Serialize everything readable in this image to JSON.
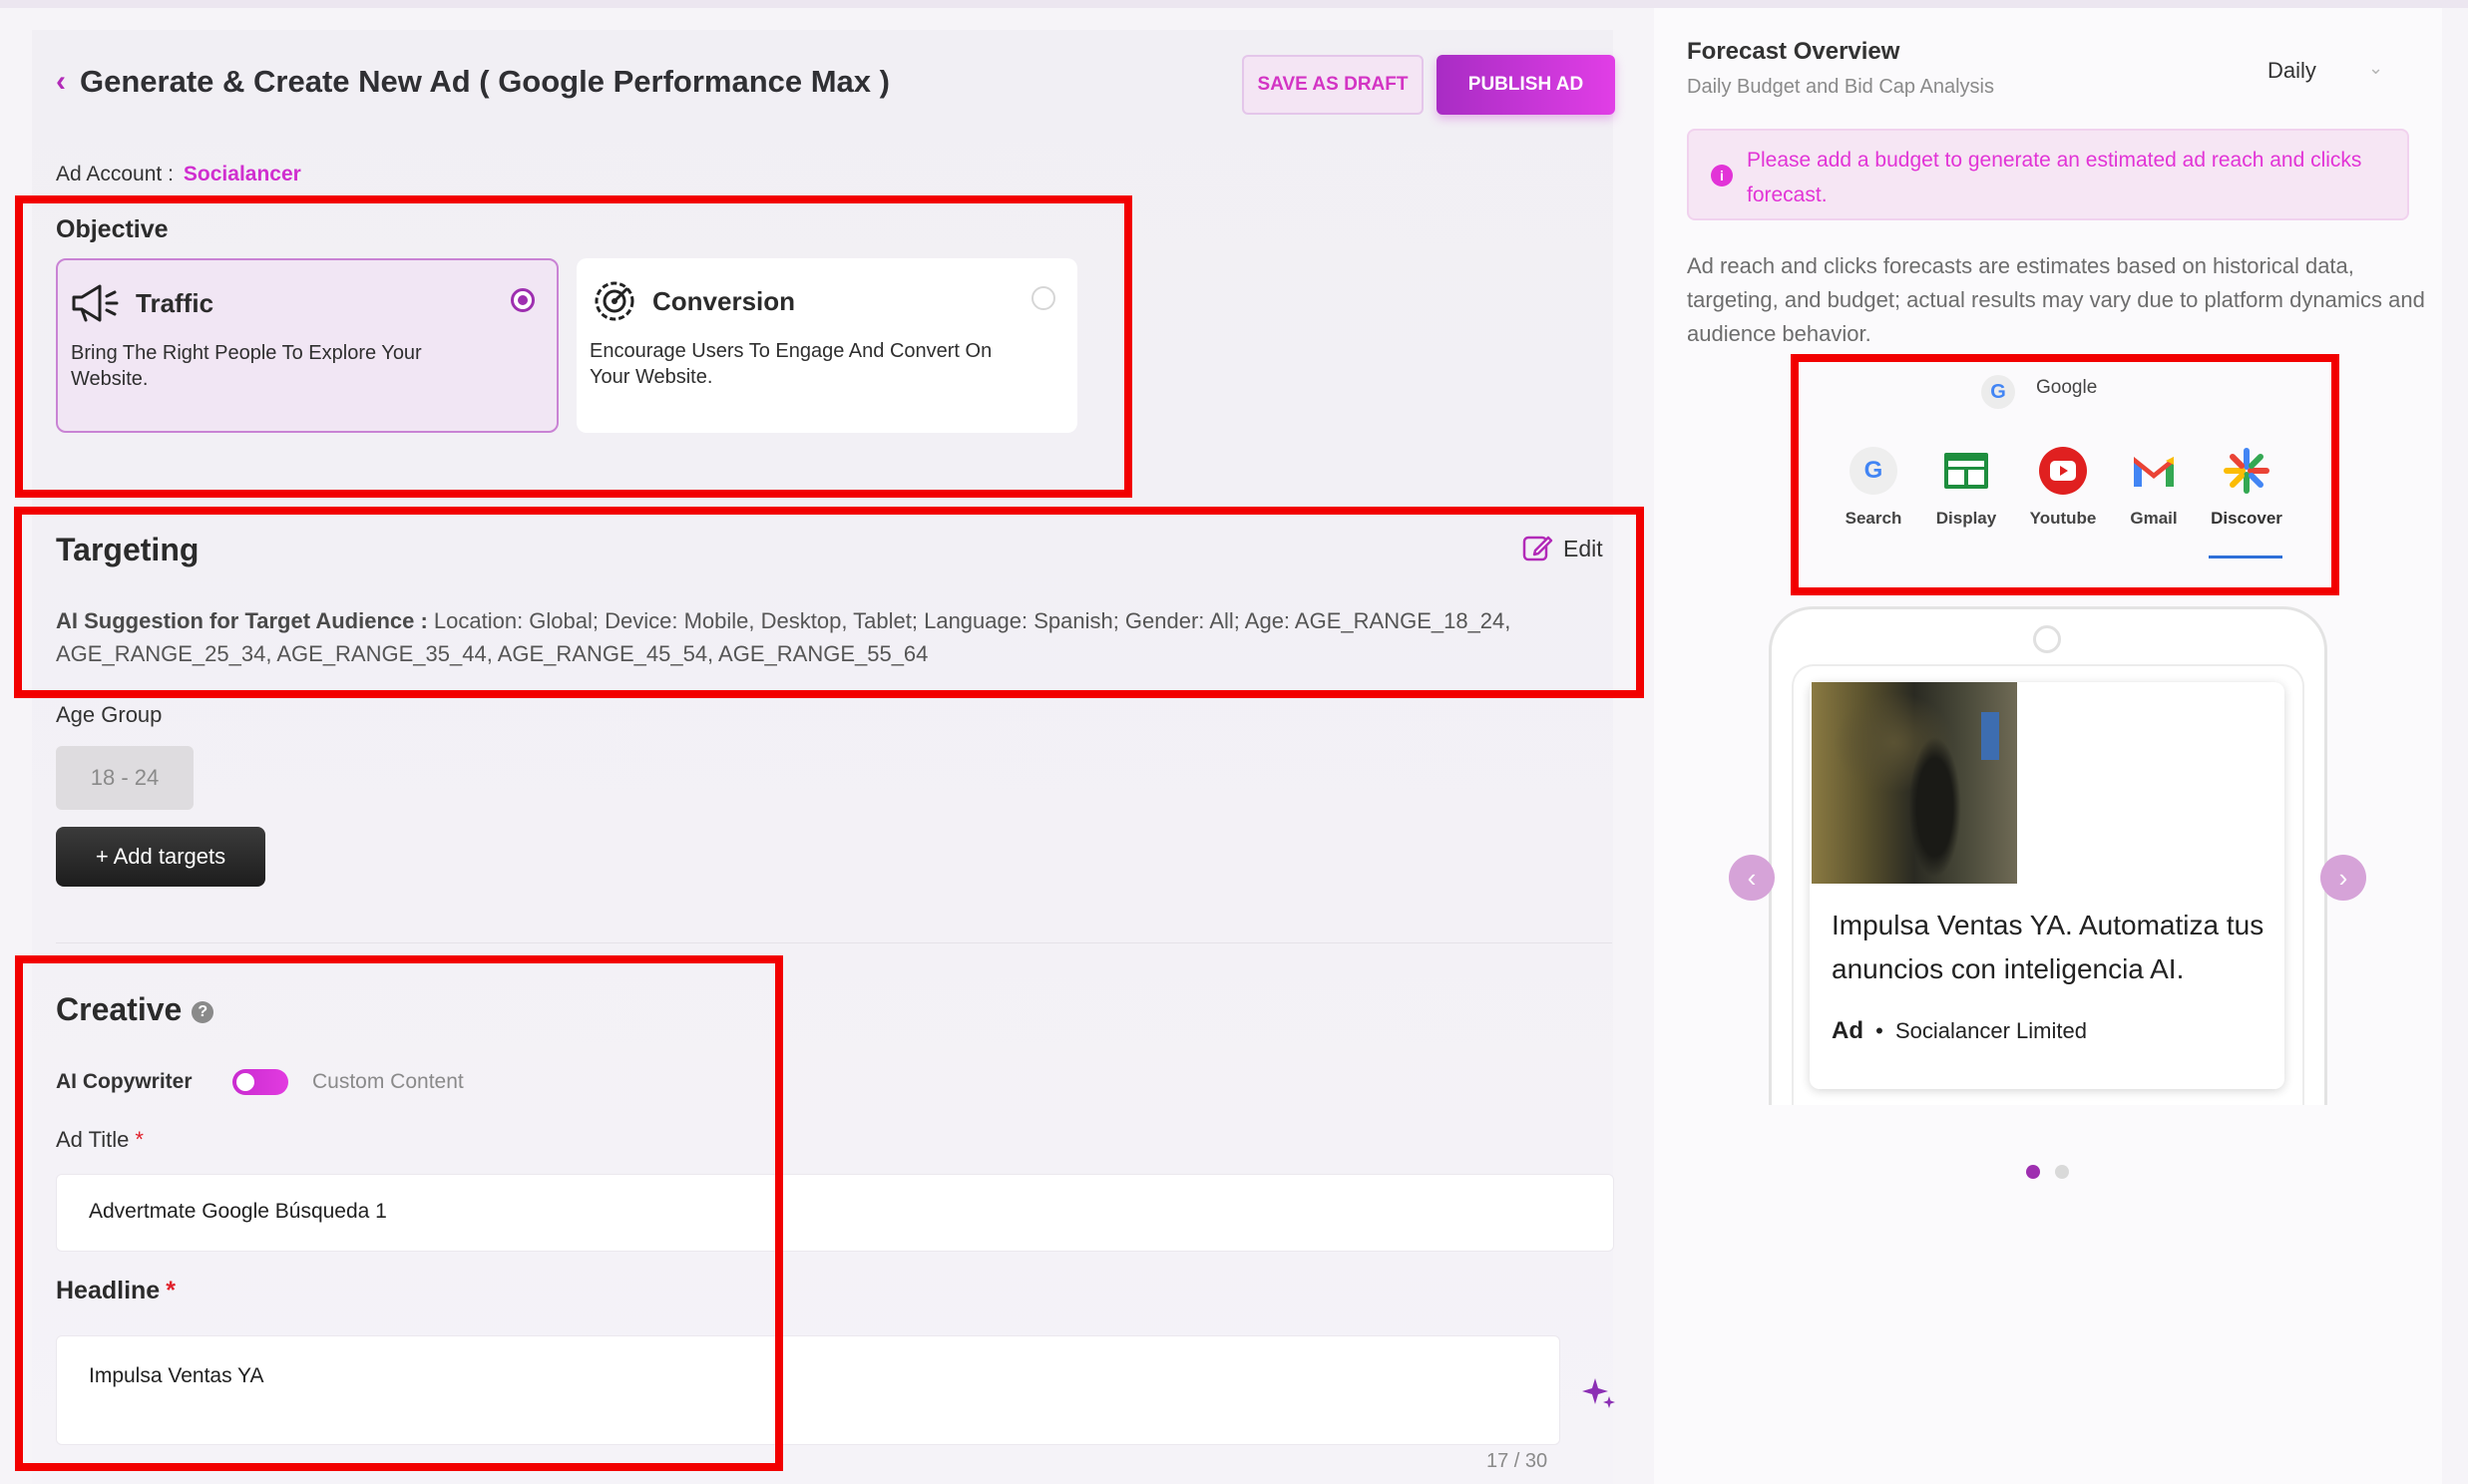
{
  "header": {
    "title": "Generate & Create New Ad ( Google Performance Max )",
    "save_draft": "SAVE AS DRAFT",
    "publish": "PUBLISH AD"
  },
  "ad_account": {
    "label": "Ad Account :",
    "value": "Socialancer"
  },
  "objective": {
    "heading": "Objective",
    "options": [
      {
        "title": "Traffic",
        "desc": "Bring The Right People To Explore Your Website.",
        "selected": true,
        "icon": "megaphone-icon"
      },
      {
        "title": "Conversion",
        "desc": "Encourage Users To Engage And Convert On Your Website.",
        "selected": false,
        "icon": "target-gear-icon"
      }
    ]
  },
  "targeting": {
    "heading": "Targeting",
    "edit": "Edit",
    "suggestion_label": "AI Suggestion for Target Audience :",
    "suggestion_text": " Location: Global; Device: Mobile, Desktop, Tablet; Language: Spanish; Gender: All; Age: AGE_RANGE_18_24, AGE_RANGE_25_34, AGE_RANGE_35_44, AGE_RANGE_45_54, AGE_RANGE_55_64",
    "age_group_label": "Age Group",
    "age_chip": "18 - 24",
    "add_targets": "+ Add targets"
  },
  "creative": {
    "heading": "Creative",
    "ai_copywriter": "AI Copywriter",
    "custom_content": "Custom Content",
    "ad_title_label": "Ad Title",
    "ad_title_value": "Advertmate Google Búsqueda 1",
    "headline_label": "Headline",
    "headline_value": "Impulsa Ventas YA",
    "counter": "17 / 30",
    "required_mark": "*"
  },
  "forecast": {
    "title": "Forecast Overview",
    "subtitle": "Daily Budget and Bid Cap Analysis",
    "period": "Daily",
    "alert": "Please add a budget to generate an estimated ad reach and clicks forecast.",
    "disclaimer": "Ad reach and clicks forecasts are estimates based on historical data, targeting, and budget; actual results may vary due to platform dynamics and audience behavior."
  },
  "preview": {
    "network": "Google",
    "platforms": [
      "Search",
      "Display",
      "Youtube",
      "Gmail",
      "Discover"
    ],
    "active_platform": "Discover",
    "ad_headline": "Impulsa Ventas YA. Automatiza tus anuncios con inteligencia AI.",
    "ad_label": "Ad",
    "advertiser": "Socialancer Limited",
    "page_count": 2,
    "active_page": 1
  },
  "colors": {
    "accent": "#b22bb8",
    "highlight_box": "#f20000",
    "publish_gradient": [
      "#a82cc4",
      "#e13ee6"
    ]
  }
}
